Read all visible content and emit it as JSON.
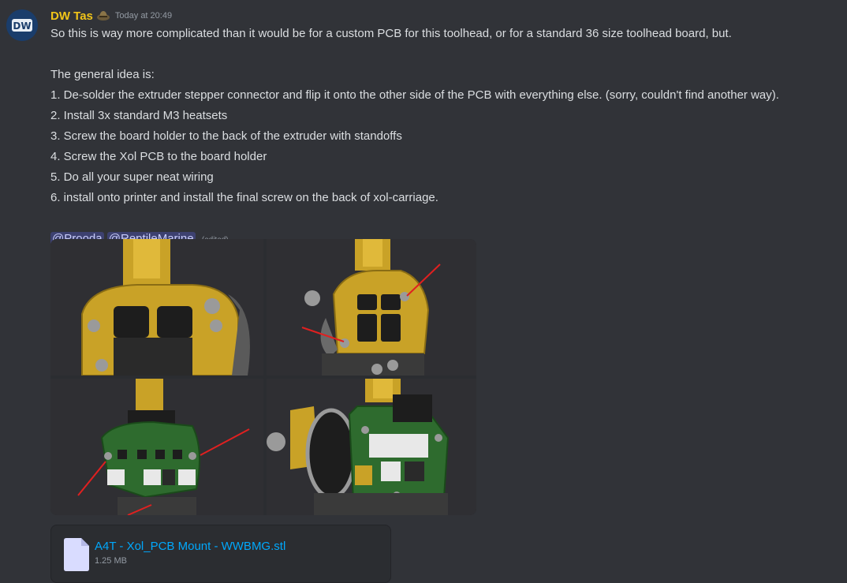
{
  "message": {
    "author": "DW Tas",
    "avatar_text": "DW",
    "timestamp": "Today at 20:49",
    "lines": [
      "So this is way more complicated than it would be for a custom PCB for this toolhead, or for a standard 36 size toolhead board, but.",
      "",
      "The general idea is:",
      "1. De-solder the extruder stepper connector and flip it onto the other side of the PCB with everything else. (sorry, couldn't find another way).",
      "2. Install 3x standard M3 heatsets",
      "3. Screw the board holder to the back of the extruder with standoffs",
      "4. Screw the Xol PCB to the board holder",
      "5. Do all your super neat wiring",
      "6. install onto printer and install the final screw on the back of xol-carriage.",
      ""
    ],
    "mentions": [
      "@Prooda",
      "@ReptileMarine"
    ],
    "edited_label": "(edited)"
  },
  "attachment": {
    "file_name": "A4T - Xol_PCB Mount - WWBMG.stl",
    "file_size": "1.25 MB"
  },
  "colors": {
    "background": "#313338",
    "username": "#f0c419",
    "link": "#00a8fc",
    "mention_bg": "#3c4270"
  }
}
